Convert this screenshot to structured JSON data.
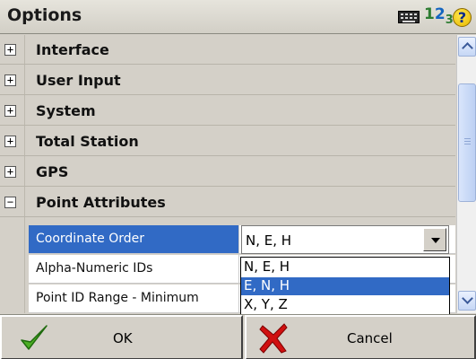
{
  "window": {
    "title": "Options"
  },
  "status_icons": [
    "keyboard-icon",
    "input-mode-icon",
    "help-icon"
  ],
  "input_mode": {
    "d1": "1",
    "d2": "2",
    "d3": "3"
  },
  "help_glyph": "?",
  "categories": [
    {
      "label": "Interface",
      "expander": "+"
    },
    {
      "label": "User Input",
      "expander": "+"
    },
    {
      "label": "System",
      "expander": "+"
    },
    {
      "label": "Total Station",
      "expander": "+"
    },
    {
      "label": "GPS",
      "expander": "+"
    },
    {
      "label": "Point Attributes",
      "expander": "−"
    }
  ],
  "properties": [
    {
      "label": "Coordinate Order",
      "value": "N, E, H",
      "selected": true
    },
    {
      "label": "Alpha-Numeric IDs",
      "value": ""
    },
    {
      "label": "Point ID Range - Minimum",
      "value": ""
    }
  ],
  "dropdown": {
    "options": [
      "N, E, H",
      "E, N, H",
      "X, Y, Z"
    ],
    "highlighted_index": 1
  },
  "buttons": {
    "ok": "OK",
    "cancel": "Cancel"
  },
  "colors": {
    "selection": "#316ac5",
    "ok_check": "#4caf24",
    "cancel_x": "#d01010"
  }
}
